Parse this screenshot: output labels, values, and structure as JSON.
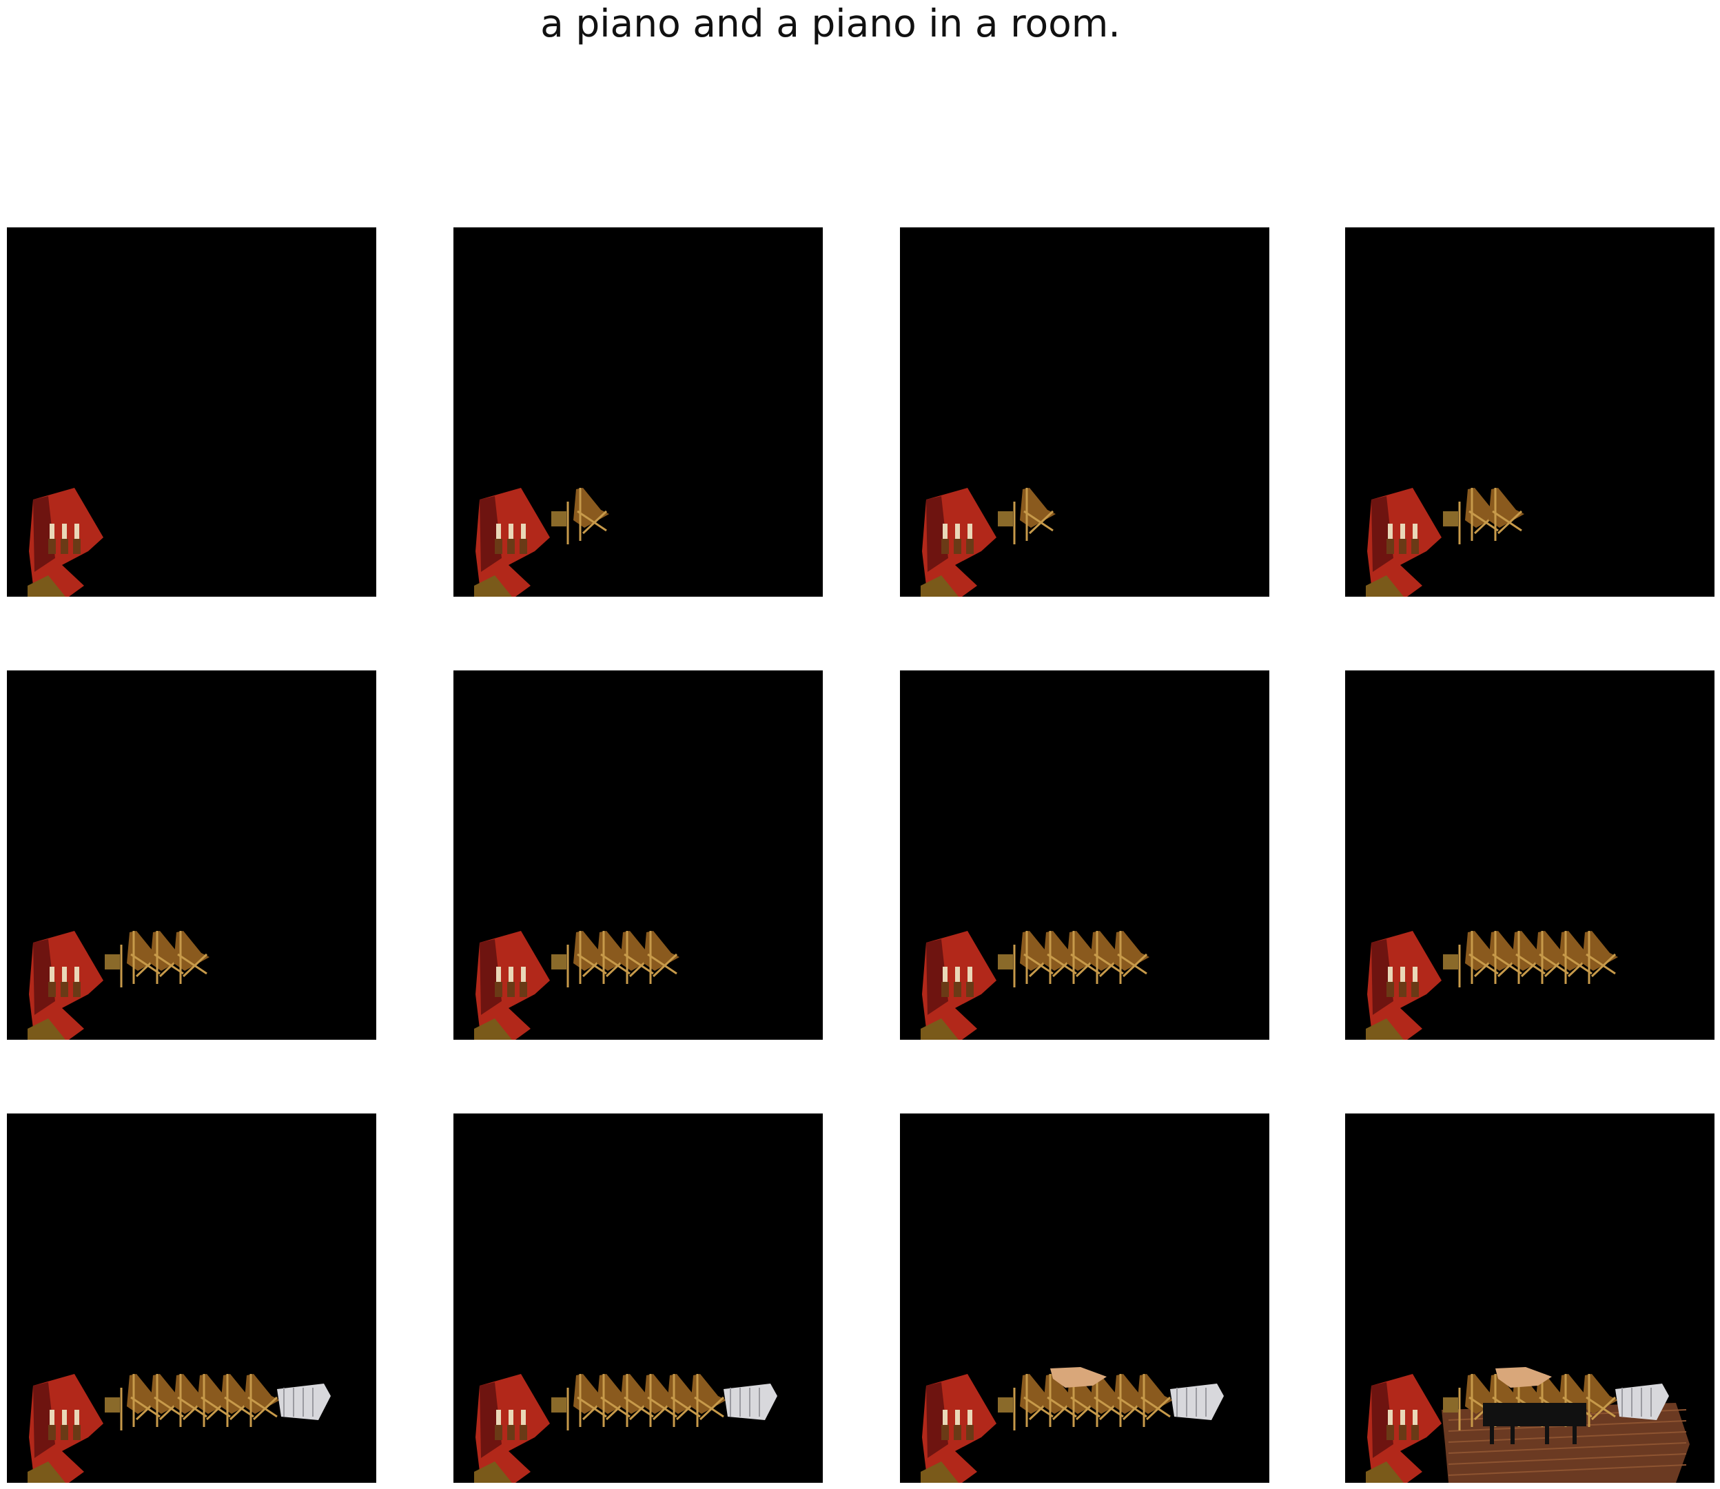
{
  "figure": {
    "title": "a piano and a piano in a room."
  },
  "panels": [
    {
      "index": 1,
      "chairs": 0,
      "silver": false,
      "tan": false,
      "floor": false,
      "piano": false
    },
    {
      "index": 2,
      "chairs": 1,
      "silver": false,
      "tan": false,
      "floor": false,
      "piano": false
    },
    {
      "index": 3,
      "chairs": 1,
      "silver": false,
      "tan": false,
      "floor": false,
      "piano": false
    },
    {
      "index": 4,
      "chairs": 2,
      "silver": false,
      "tan": false,
      "floor": false,
      "piano": false
    },
    {
      "index": 5,
      "chairs": 3,
      "silver": false,
      "tan": false,
      "floor": false,
      "piano": false
    },
    {
      "index": 6,
      "chairs": 4,
      "silver": false,
      "tan": false,
      "floor": false,
      "piano": false
    },
    {
      "index": 7,
      "chairs": 5,
      "silver": false,
      "tan": false,
      "floor": false,
      "piano": false
    },
    {
      "index": 8,
      "chairs": 6,
      "silver": false,
      "tan": false,
      "floor": false,
      "piano": false
    },
    {
      "index": 9,
      "chairs": 6,
      "silver": true,
      "tan": false,
      "floor": false,
      "piano": false
    },
    {
      "index": 10,
      "chairs": 6,
      "silver": true,
      "tan": false,
      "floor": false,
      "piano": false
    },
    {
      "index": 11,
      "chairs": 6,
      "silver": true,
      "tan": true,
      "floor": false,
      "piano": false
    },
    {
      "index": 12,
      "chairs": 6,
      "silver": true,
      "tan": true,
      "floor": true,
      "piano": true
    }
  ],
  "colors": {
    "background": "#000000",
    "red_chair": "#b2281a",
    "red_chair_dark": "#6e1410",
    "wood_chair": "#8a5a1e",
    "wood_chair_light": "#c79a4a",
    "silver": "#d8d8dc",
    "tan": "#d9a77a",
    "floor": "#6b3a22",
    "floor_light": "#8e5431",
    "piano": "#111111"
  }
}
